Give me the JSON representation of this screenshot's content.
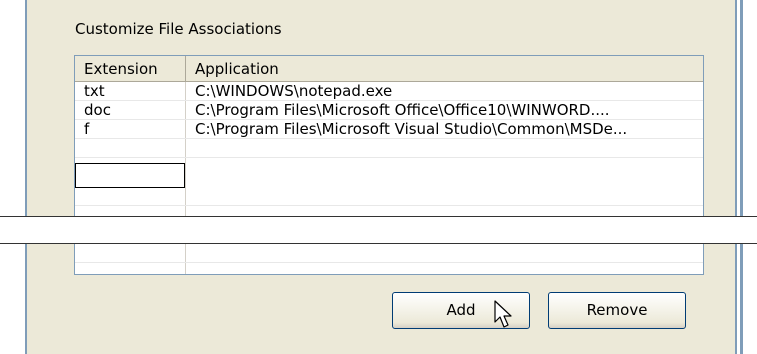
{
  "group_title": "Customize File Associations",
  "table": {
    "headers": [
      "Extension",
      "Application"
    ],
    "rows": [
      {
        "extension": "txt",
        "application": "C:\\WINDOWS\\notepad.exe"
      },
      {
        "extension": "doc",
        "application": "C:\\Program Files\\Microsoft Office\\Office10\\WINWORD...."
      },
      {
        "extension": "f",
        "application": "C:\\Program Files\\Microsoft Visual Studio\\Common\\MSDe..."
      }
    ],
    "new_row_extension": ""
  },
  "buttons": {
    "add": "Add",
    "remove": "Remove"
  },
  "colors": {
    "panel_bg": "#ece9d8",
    "border": "#7f9db9",
    "button_border": "#003c74"
  }
}
